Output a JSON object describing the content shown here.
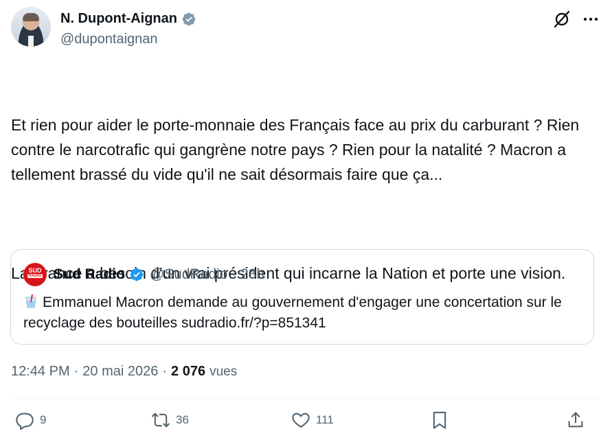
{
  "author": {
    "display_name": "N. Dupont-Aignan",
    "handle": "@dupontaignan"
  },
  "tweet": {
    "paragraphs": [
      "Et rien pour aider le porte-monnaie des Français face au prix du carburant ? Rien contre le narcotrafic qui gangrène notre pays ? Rien pour la natalité ? Macron a tellement brassé du vide qu'il ne sait désormais faire que ça...",
      "La France a besoin d'un vrai président qui incarne la Nation et porte une vision."
    ]
  },
  "quote": {
    "avatar_text_top": "SUD",
    "avatar_text_bottom": "RADIO",
    "name": "Sud Radio",
    "handle_time": "@SudRadio · 23h",
    "text": "Emmanuel Macron demande au gouvernement d'engager une concertation sur le recyclage des bouteilles sudradio.fr/?p=851341"
  },
  "meta": {
    "time": "12:44 PM",
    "sep1": "·",
    "date": "20 mai 2026",
    "sep2": "·",
    "views_count": "2 076",
    "views_label": "vues"
  },
  "actions": {
    "reply_count": "9",
    "retweet_count": "36",
    "like_count": "111"
  },
  "colors": {
    "verified_gray": "#829aab",
    "verified_blue": "#1d9bf0",
    "secondary_text": "#536471",
    "primary_text": "#0f1419",
    "border": "#cfd9de",
    "sud_radio_red": "#d7141a"
  },
  "icons": [
    "verified-gray-icon",
    "grok-icon",
    "more-icon",
    "verified-blue-icon",
    "cup-emoji-icon",
    "reply-icon",
    "retweet-icon",
    "like-icon",
    "bookmark-icon",
    "share-icon"
  ]
}
